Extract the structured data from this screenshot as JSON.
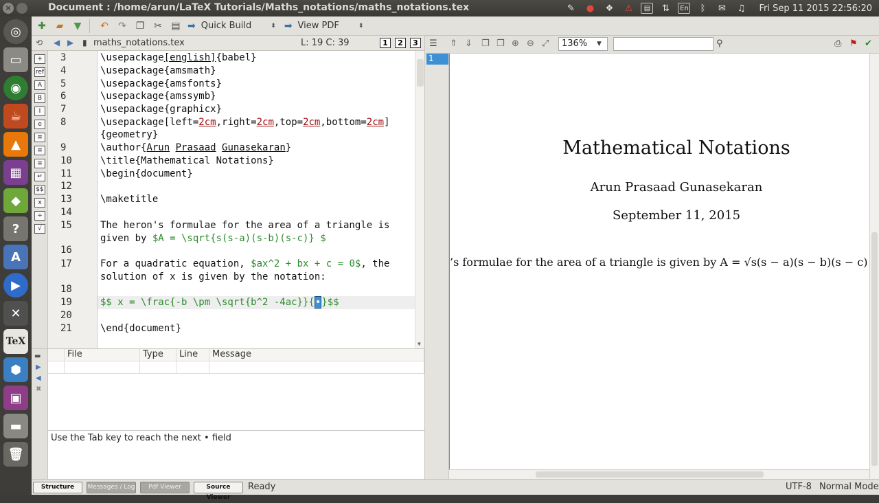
{
  "window": {
    "title": "Document : /home/arun/LaTeX Tutorials/Maths_notations/maths_notations.tex"
  },
  "panel": {
    "keyboard_layout": "En",
    "clock": "Fri Sep 11 2015 22:56:20",
    "tray_icons": [
      "edit-icon",
      "record-icon",
      "dropbox-icon",
      "warning-icon",
      "clipboard-icon",
      "network-icon",
      "keyboard-icon",
      "bluetooth-icon",
      "mail-icon",
      "volume-icon"
    ]
  },
  "launcher": {
    "items": [
      "dash-icon",
      "files-icon",
      "chrome-icon",
      "teapot-icon",
      "vlc-icon",
      "video-icon",
      "cube-icon",
      "help-icon",
      "font-icon",
      "media-icon",
      "x-icon",
      "tex-icon",
      "virtualbox-icon",
      "workspace-icon",
      "drive-icon",
      "trash-icon"
    ]
  },
  "toolbar": {
    "quick_build": "Quick Build",
    "view_pdf": "View PDF"
  },
  "editor_tabs": {
    "file_name": "maths_notations.tex",
    "cursor_pos": "L: 19 C: 39",
    "views": [
      "1",
      "2",
      "3"
    ]
  },
  "editor": {
    "lines": [
      {
        "n": "3"
      },
      {
        "n": "4"
      },
      {
        "n": "5"
      },
      {
        "n": "6"
      },
      {
        "n": "7"
      },
      {
        "n": "8"
      },
      {
        "n": "9"
      },
      {
        "n": "10"
      },
      {
        "n": "11"
      },
      {
        "n": "12"
      },
      {
        "n": "13"
      },
      {
        "n": "14"
      },
      {
        "n": "15"
      },
      {
        "n": "16"
      },
      {
        "n": "17"
      },
      {
        "n": "18"
      },
      {
        "n": "19"
      },
      {
        "n": "20"
      },
      {
        "n": "21"
      }
    ],
    "code": {
      "l3a": "\\usepackage",
      "l3b": "[english]",
      "l3c": "{babel}",
      "l4": "\\usepackage{amsmath}",
      "l5": "\\usepackage{amsfonts}",
      "l6": "\\usepackage{amssymb}",
      "l7": "\\usepackage{graphicx}",
      "l8a": "\\usepackage",
      "l8b": "[left=",
      "l8c": "2cm",
      "l8d": ",right=",
      "l8e": "2cm",
      "l8f": ",top=",
      "l8g": "2cm",
      "l8h": ",bottom=",
      "l8i": "2cm",
      "l8j": "]",
      "l8k": "{geometry}",
      "l9a": "\\author{",
      "l9b": "Arun",
      "l9c": " ",
      "l9d": "Prasaad",
      "l9e": " ",
      "l9f": "Gunasekaran",
      "l9g": "}",
      "l10": "\\title{Mathematical Notations}",
      "l11": "\\begin{document}",
      "l13": "\\maketitle",
      "l15a": "The heron's formulae for the area of a triangle is",
      "l15b": "given by ",
      "l15c": "$A = \\sqrt{s(s-a)(s-b)(s-c)} $",
      "l17a": "For a quadratic equation, ",
      "l17b": "$ax^2 + bx + c = 0$",
      "l17c": ", the",
      "l17d": "solution of x is given by the notation:",
      "l19a": "$$ x = \\frac{-b \\pm \\sqrt{b^2 -4ac}}{",
      "l19b": "•",
      "l19c": "}$$",
      "l21": "\\end{document}"
    }
  },
  "messages": {
    "columns": [
      "File",
      "Type",
      "Line",
      "Message"
    ],
    "hint": "Use the Tab key to reach the next • field"
  },
  "pdf": {
    "zoom": "136%",
    "page_number": "1",
    "title": "Mathematical Notations",
    "author": "Arun Prasaad Gunasekaran",
    "date": "September 11, 2015",
    "body": "’s formulae for the area of a triangle is given by A = √s(s − a)(s − b)(s − c)"
  },
  "statusbar": {
    "buttons": [
      "Structure",
      "Messages / Log",
      "Pdf Viewer",
      "Source Viewer"
    ],
    "status": "Ready",
    "encoding": "UTF-8",
    "mode": "Normal Mode"
  }
}
